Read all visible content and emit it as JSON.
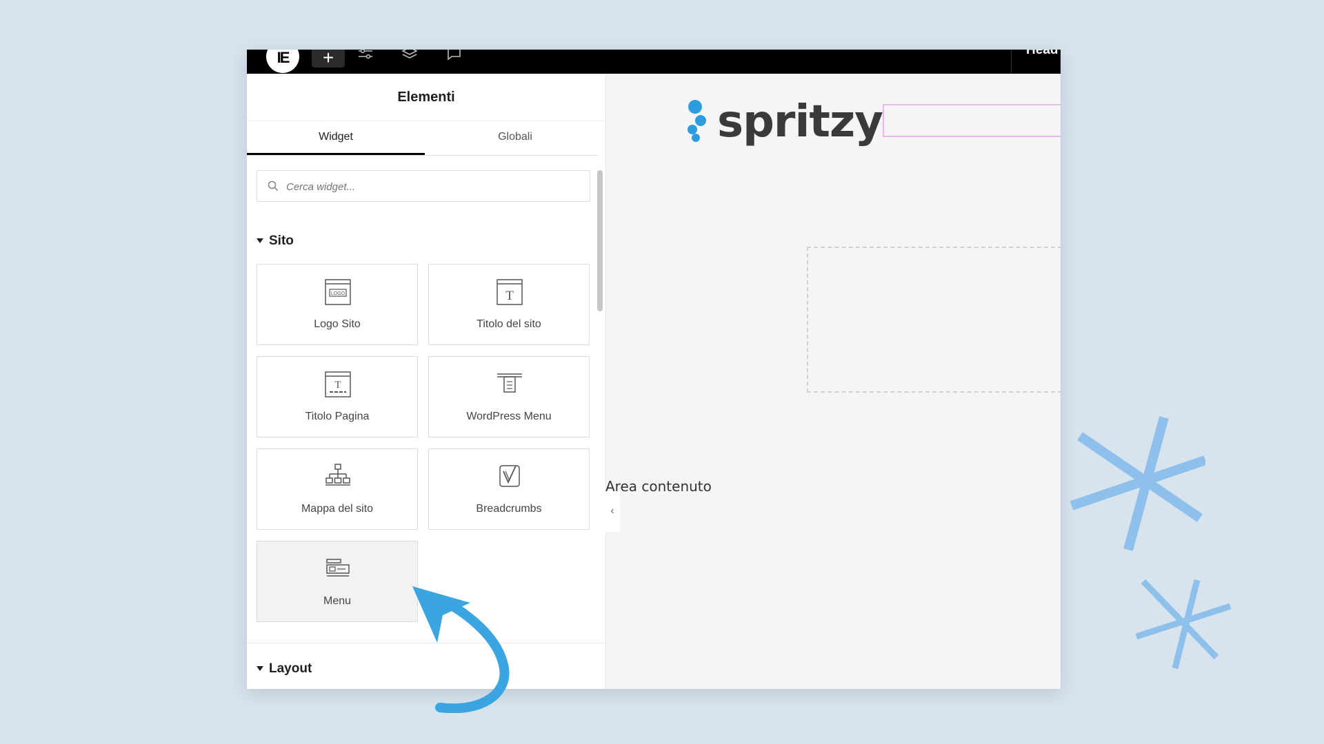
{
  "topbar": {
    "logo_glyph": "IE",
    "add_glyph": "+",
    "title": "Head",
    "icons": [
      "elementor-logo-icon",
      "plus-icon",
      "sliders-icon",
      "layers-icon",
      "comment-icon"
    ]
  },
  "panel": {
    "title": "Elementi",
    "tabs": [
      {
        "label": "Widget",
        "active": true
      },
      {
        "label": "Globali",
        "active": false
      }
    ],
    "search_placeholder": "Cerca widget...",
    "sections": [
      {
        "name": "Sito",
        "widgets": [
          {
            "label": "Logo Sito",
            "icon": "site-logo-icon"
          },
          {
            "label": "Titolo del sito",
            "icon": "site-title-icon"
          },
          {
            "label": "Titolo Pagina",
            "icon": "page-title-icon"
          },
          {
            "label": "WordPress Menu",
            "icon": "wordpress-menu-icon"
          },
          {
            "label": "Mappa del sito",
            "icon": "sitemap-icon"
          },
          {
            "label": "Breadcrumbs",
            "icon": "breadcrumbs-icon"
          },
          {
            "label": "Menu",
            "icon": "menu-icon"
          }
        ]
      },
      {
        "name": "Layout",
        "widgets": []
      }
    ],
    "collapse_glyph": "‹"
  },
  "canvas": {
    "brand": "spritzy",
    "content_area_label": "Area contenuto"
  },
  "colors": {
    "background": "#d7e3ed",
    "arrow": "#3aa5e0",
    "asterisk": "#8dc0ea",
    "brand_dot": "#2d9ddf",
    "brand_text": "#3a3a3a"
  }
}
